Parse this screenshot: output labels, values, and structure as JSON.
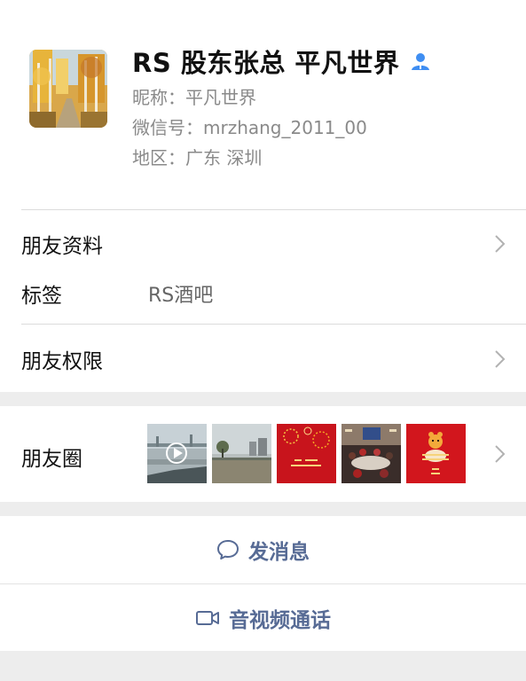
{
  "profile": {
    "display_name": "RS 股东张总 平凡世界",
    "nickname_label": "昵称：",
    "nickname": "平凡世界",
    "wechat_id_label": "微信号：",
    "wechat_id": "mrzhang_2011_00",
    "region_label": "地区：",
    "region": "广东  深圳",
    "avatar_icon": "autumn-forest-avatar",
    "contact_icon": "person-icon",
    "accent_color": "#3f8ef2"
  },
  "details": {
    "friend_info_label": "朋友资料",
    "tags_label": "标签",
    "tags_value": "RS酒吧",
    "permissions_label": "朋友权限"
  },
  "moments": {
    "label": "朋友圈",
    "thumbnails": [
      "video-road-thumb",
      "roadside-tree-thumb",
      "red-fireworks-card-thumb",
      "banquet-hall-thumb",
      "tiger-new-year-thumb"
    ]
  },
  "actions": {
    "send_message_label": "发消息",
    "video_call_label": "音视频通话",
    "link_color": "#576b95"
  }
}
